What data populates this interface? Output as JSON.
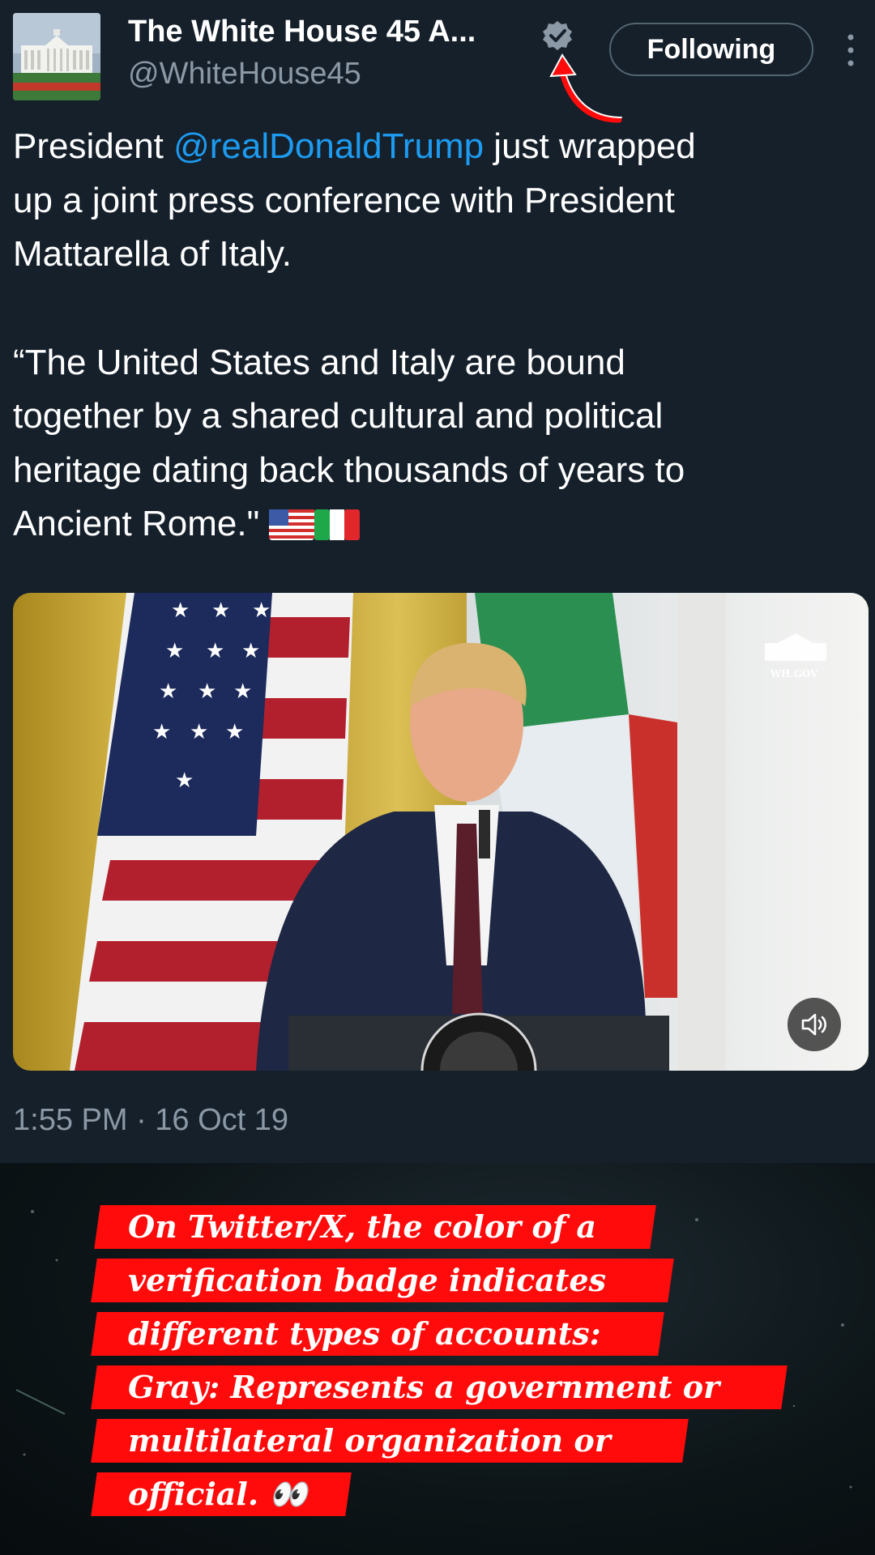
{
  "account": {
    "display_name": "The White House 45 A...",
    "handle": "@WhiteHouse45",
    "follow_label": "Following",
    "verified_badge_color": "#8b98a5",
    "avatar_icon": "white-house-icon"
  },
  "tweet": {
    "prefix": "President ",
    "mention": "@realDonaldTrump",
    "line1_rest": " just wrapped",
    "line2": "up a joint press conference with President",
    "line3": "Mattarella of Italy.",
    "quote_line1": "“The United States and Italy are bound",
    "quote_line2": "together by a shared cultural and political",
    "quote_line3": "heritage dating back thousands of years to",
    "quote_line4": "Ancient Rome.\" ",
    "flags": [
      "us-flag-emoji",
      "italy-flag-emoji"
    ],
    "timestamp": "1:55 PM · 16 Oct 19"
  },
  "media": {
    "watermark": "WH.GOV",
    "mute_icon": "speaker-muted-icon"
  },
  "caption": {
    "lines": [
      "On Twitter/X, the color of a",
      "verification badge indicates",
      "different types of accounts:",
      "Gray: Represents a government or",
      "multilateral organization or",
      "official. 👀"
    ],
    "bar_color": "#ff0b0b"
  },
  "colors": {
    "background": "#15202b",
    "mention": "#1d9bf0",
    "secondary_text": "#8b98a5",
    "annotation_arrow": "#ff0b0b"
  }
}
